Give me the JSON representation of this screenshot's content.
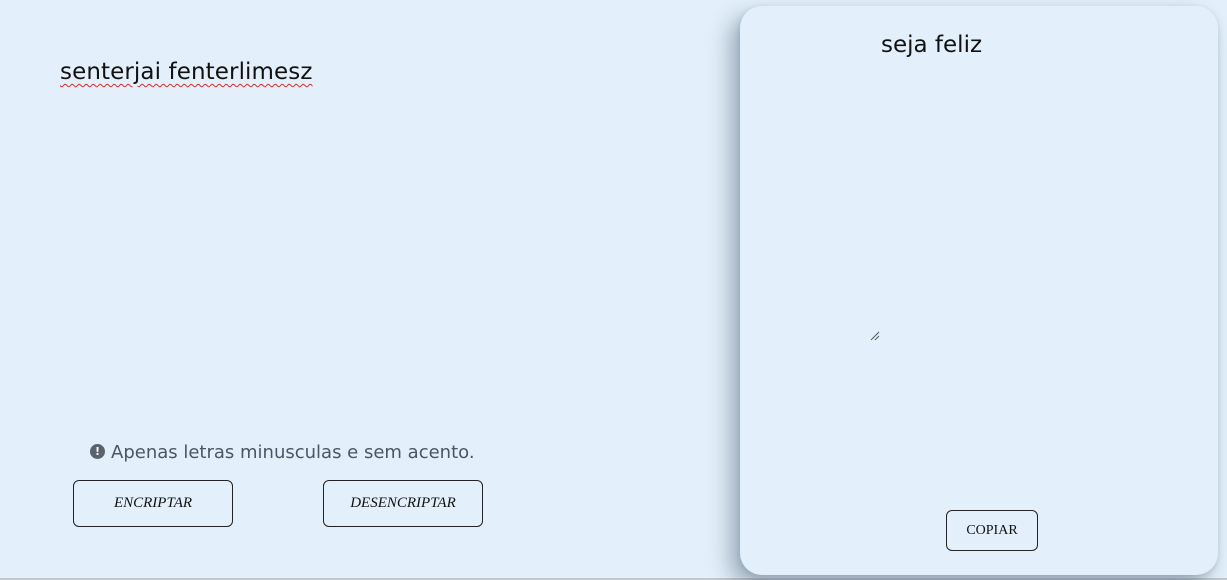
{
  "input": {
    "value": "senterjai fenterlimesz"
  },
  "hint": {
    "icon": "exclamation-circle-icon",
    "text": "Apenas letras minusculas e sem acento."
  },
  "buttons": {
    "encrypt_label": "ENCRIPTAR",
    "decrypt_label": "DESENCRIPTAR",
    "copy_label": "COPIAR"
  },
  "output": {
    "value": "seja feliz"
  },
  "colors": {
    "background": "#e3f0fb",
    "text": "#111111",
    "hint_text": "#4b5563",
    "spellcheck_underline": "#d62a2a"
  }
}
